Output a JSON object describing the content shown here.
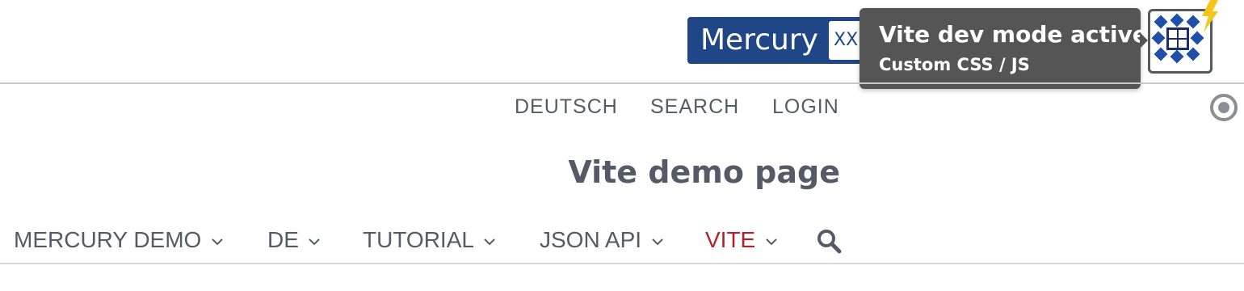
{
  "toolbar": {
    "badge": {
      "name": "Mercury",
      "size_label": "XXL"
    },
    "tooltip": {
      "title": "Vite dev mode active",
      "subtitle": "Custom CSS / JS"
    },
    "vite_button": {
      "icon": "vite-mode-icon",
      "accent": "#f5c518",
      "tile_color": "#1f4fa8"
    }
  },
  "meta_nav": {
    "items": [
      {
        "label": "DEUTSCH"
      },
      {
        "label": "SEARCH"
      },
      {
        "label": "LOGIN"
      }
    ],
    "target_icon": "target-icon"
  },
  "page": {
    "title": "Vite demo page"
  },
  "main_nav": {
    "items": [
      {
        "label": "MERCURY DEMO",
        "active": false
      },
      {
        "label": "DE",
        "active": false
      },
      {
        "label": "TUTORIAL",
        "active": false
      },
      {
        "label": "JSON API",
        "active": false
      },
      {
        "label": "VITE",
        "active": true
      }
    ],
    "search_icon": "search-icon"
  },
  "colors": {
    "brand_blue": "#1f4788",
    "text": "#555b66",
    "active_red": "#b0222a",
    "tooltip_bg": "#555555"
  }
}
